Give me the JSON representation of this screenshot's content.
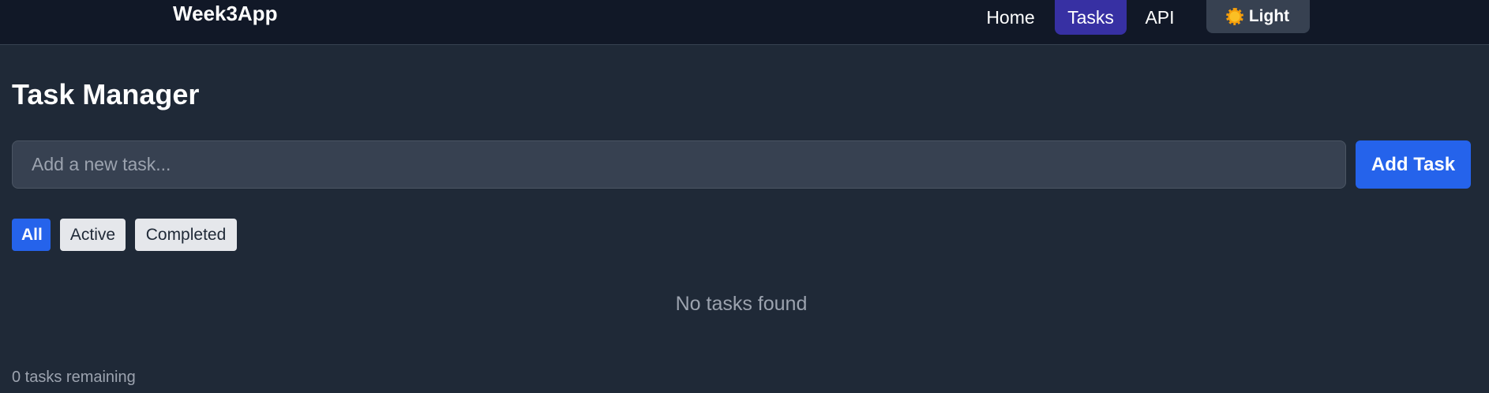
{
  "app": {
    "brand": "Week3App"
  },
  "nav": {
    "home": "Home",
    "tasks": "Tasks",
    "api": "API",
    "active": "Tasks"
  },
  "theme_toggle": {
    "icon": "sun-icon",
    "label": "Light"
  },
  "main": {
    "title": "Task Manager",
    "input": {
      "value": "",
      "placeholder": "Add a new task..."
    },
    "add_button": "Add Task",
    "filters": {
      "all": "All",
      "active": "Active",
      "completed": "Completed",
      "selected": "All"
    },
    "empty_message": "No tasks found",
    "remaining": "0 tasks remaining"
  },
  "colors": {
    "navbar_bg": "#111827",
    "page_bg": "#1f2937",
    "active_nav": "#3730a3",
    "accent": "#2563eb"
  }
}
